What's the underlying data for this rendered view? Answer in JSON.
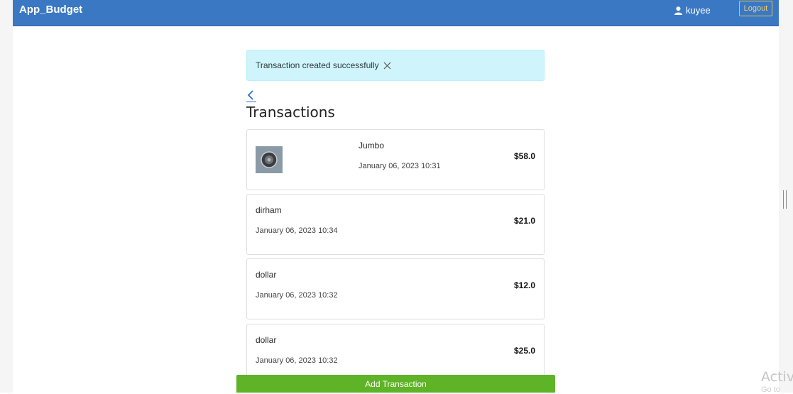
{
  "app": {
    "title": "App_Budget"
  },
  "header": {
    "username": "kuyee",
    "logout_label": "Logout"
  },
  "alert": {
    "message": "Transaction created successfully"
  },
  "page": {
    "title": "Transactions"
  },
  "transactions": [
    {
      "name": "Jumbo",
      "date": "January 06, 2023 10:31",
      "amount": "$58.0",
      "has_image": true
    },
    {
      "name": "dirham",
      "date": "January 06, 2023 10:34",
      "amount": "$21.0"
    },
    {
      "name": "dollar",
      "date": "January 06, 2023 10:32",
      "amount": "$12.0"
    },
    {
      "name": "dollar",
      "date": "January 06, 2023 10:32",
      "amount": "$25.0"
    }
  ],
  "actions": {
    "add_label": "Add Transaction"
  },
  "overlay": {
    "watermark": "Activ",
    "watermark_sub": "Go to"
  },
  "colors": {
    "navbar": "#3b78c4",
    "alert_bg": "#cff4fc",
    "add_button": "#5fb326",
    "logout_border": "#e8c24a"
  },
  "icons": {
    "user": "user-icon",
    "close": "close-icon",
    "back": "chevron-left-icon",
    "thumbnail": "coin-thumbnail"
  }
}
